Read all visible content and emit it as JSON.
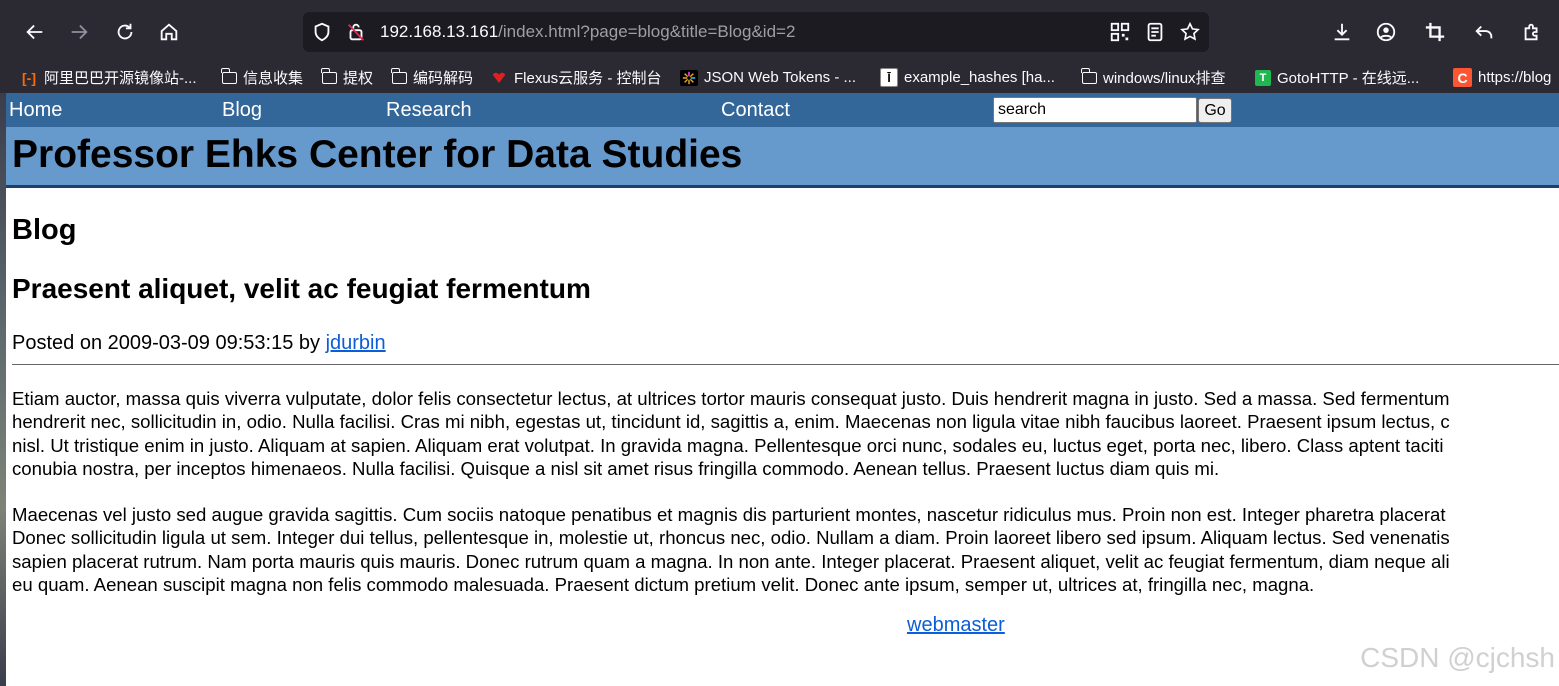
{
  "browser": {
    "url_host": "192.168.13.161",
    "url_path": "/index.html?page=blog&title=Blog&id=2",
    "bookmarks": [
      {
        "label": "阿里巴巴开源镜像站-...",
        "icon": "alibaba-icon",
        "color": "#ff6a00"
      },
      {
        "label": "信息收集",
        "icon": "folder-icon"
      },
      {
        "label": "提权",
        "icon": "folder-icon"
      },
      {
        "label": "编码解码",
        "icon": "folder-icon"
      },
      {
        "label": "Flexus云服务 - 控制台",
        "icon": "huawei-icon",
        "color": "#e02020"
      },
      {
        "label": "JSON Web Tokens - ...",
        "icon": "jwt-icon"
      },
      {
        "label": "example_hashes [ha...",
        "icon": "hashcat-icon"
      },
      {
        "label": "windows/linux排查",
        "icon": "folder-icon"
      },
      {
        "label": "GotoHTTP - 在线远...",
        "icon": "gotohttp-icon",
        "color": "#1fb850"
      },
      {
        "label": "https://blog",
        "icon": "csdn-icon",
        "color": "#fc5531"
      }
    ]
  },
  "nav": {
    "items": [
      "Home",
      "Blog",
      "Research",
      "Contact"
    ],
    "search_value": "search",
    "go_label": "Go"
  },
  "header": {
    "title": "Professor Ehks Center for Data Studies"
  },
  "main": {
    "section_title": "Blog",
    "post_title": "Praesent aliquet, velit ac feugiat fermentum",
    "posted_prefix": "Posted on 2009-03-09 09:53:15 by ",
    "author": "jdurbin",
    "paragraph1": [
      "Etiam auctor, massa quis viverra vulputate, dolor felis consectetur lectus, at ultrices tortor mauris consequat justo. Duis hendrerit magna in justo. Sed a massa. Sed fermentum",
      "hendrerit nec, sollicitudin in, odio. Nulla facilisi. Cras mi nibh, egestas ut, tincidunt id, sagittis a, enim. Maecenas non ligula vitae nibh faucibus laoreet. Praesent ipsum lectus, c",
      "nisl. Ut tristique enim in justo. Aliquam at sapien. Aliquam erat volutpat. In gravida magna. Pellentesque orci nunc, sodales eu, luctus eget, porta nec, libero. Class aptent taciti",
      "conubia nostra, per inceptos himenaeos. Nulla facilisi. Quisque a nisl sit amet risus fringilla commodo. Aenean tellus. Praesent luctus diam quis mi."
    ],
    "paragraph2": [
      "Maecenas vel justo sed augue gravida sagittis. Cum sociis natoque penatibus et magnis dis parturient montes, nascetur ridiculus mus. Proin non est. Integer pharetra placerat",
      "Donec sollicitudin ligula ut sem. Integer dui tellus, pellentesque in, molestie ut, rhoncus nec, odio. Nullam a diam. Proin laoreet libero sed ipsum. Aliquam lectus. Sed venenatis",
      "sapien placerat rutrum. Nam porta mauris quis mauris. Donec rutrum quam a magna. In non ante. Integer placerat. Praesent aliquet, velit ac feugiat fermentum, diam neque ali",
      "eu quam. Aenean suscipit magna non felis commodo malesuada. Praesent dictum pretium velit. Donec ante ipsum, semper ut, ultrices at, fringilla nec, magna."
    ],
    "footer_link": "webmaster"
  },
  "watermark": "CSDN @cjchsh"
}
